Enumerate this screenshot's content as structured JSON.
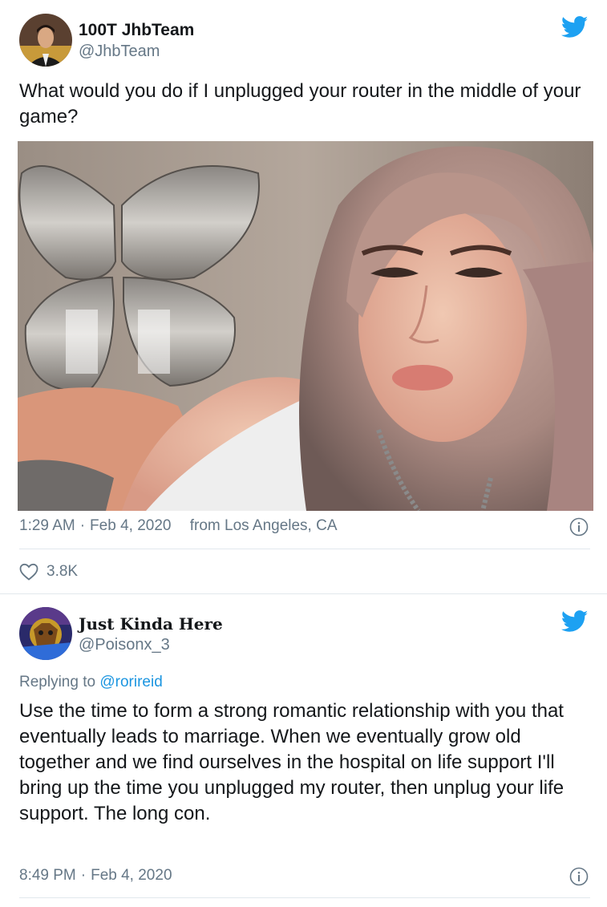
{
  "tweet1": {
    "display_name": "100T JhbTeam",
    "handle": "@JhbTeam",
    "text": "What would you do if I unplugged your router in the middle of your game?",
    "time": "1:29 AM",
    "separator": "·",
    "date": "Feb 4, 2020",
    "location": "from Los Angeles, CA",
    "likes": "3.8K",
    "icons": [
      "avatar",
      "twitter-bird-icon",
      "info-icon",
      "heart-icon"
    ]
  },
  "tweet2": {
    "display_name": "Just Kinda Here",
    "handle": "@Poisonx_3",
    "replying_prefix": "Replying to",
    "replying_to": "@rorireid",
    "text": "Use the time to form a strong romantic relationship with you that eventually leads to marriage. When we eventually grow old together and we find ourselves in the hospital on life support I'll bring up the time you unplugged my router, then unplug your life support. The long con.",
    "time": "8:49 PM",
    "separator": "·",
    "date": "Feb 4, 2020",
    "icons": [
      "avatar",
      "twitter-bird-icon",
      "info-icon"
    ]
  },
  "colors": {
    "twitter_blue": "#1da1f2",
    "secondary_text": "#657786",
    "link": "#1b95e0",
    "divider": "#e1e8ed"
  }
}
